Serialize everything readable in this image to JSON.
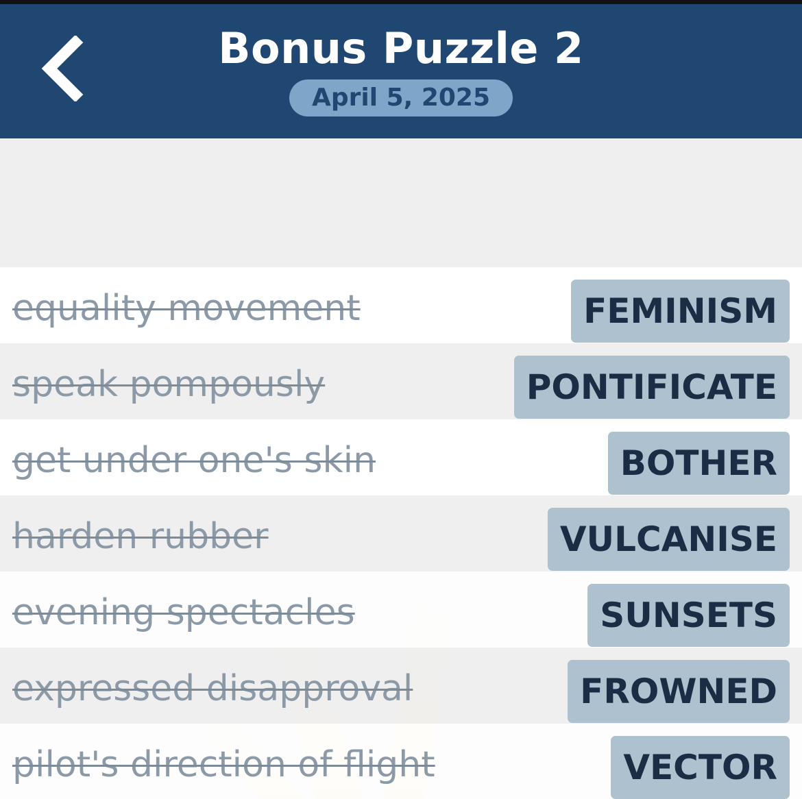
{
  "header": {
    "title": "Bonus Puzzle 2",
    "date": "April 5, 2025",
    "back_icon": "chevron-left-icon"
  },
  "colors": {
    "header_bg": "#1f4771",
    "date_pill_bg": "#7fa6c8",
    "answer_bg": "#aec1cf",
    "answer_text": "#1b2d44",
    "clue_text": "#8c9aa8"
  },
  "rows": [
    {
      "clue": "equality movement",
      "answer": "FEMINISM"
    },
    {
      "clue": "speak pompously",
      "answer": "PONTIFICATE"
    },
    {
      "clue": "get under one's skin",
      "answer": "BOTHER"
    },
    {
      "clue": "harden rubber",
      "answer": "VULCANISE"
    },
    {
      "clue": "evening spectacles",
      "answer": "SUNSETS"
    },
    {
      "clue": "expressed disapproval",
      "answer": "FROWNED"
    },
    {
      "clue": "pilot's direction of flight",
      "answer": "VECTOR"
    }
  ]
}
